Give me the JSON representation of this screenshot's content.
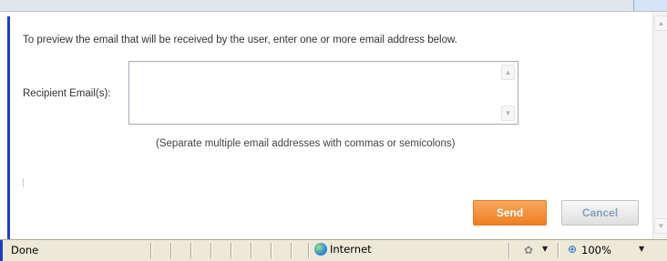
{
  "dialog": {
    "instruction": "To preview the email that will be received by the user, enter one or more email address below.",
    "recipient_label": "Recipient Email(s):",
    "recipient_value": "",
    "hint": "(Separate multiple email addresses with commas or semicolons)",
    "send_label": "Send",
    "cancel_label": "Cancel"
  },
  "status_bar": {
    "status": "Done",
    "zone": "Internet",
    "zoom": "100%"
  },
  "colors": {
    "send_button": "#ee7f22",
    "cancel_text": "#8aa0bd",
    "status_bar_bg": "#ece9d8"
  },
  "icons": {
    "zone": "globe-icon",
    "protected_mode": "protected-mode-icon",
    "zoom": "magnifier-icon"
  }
}
